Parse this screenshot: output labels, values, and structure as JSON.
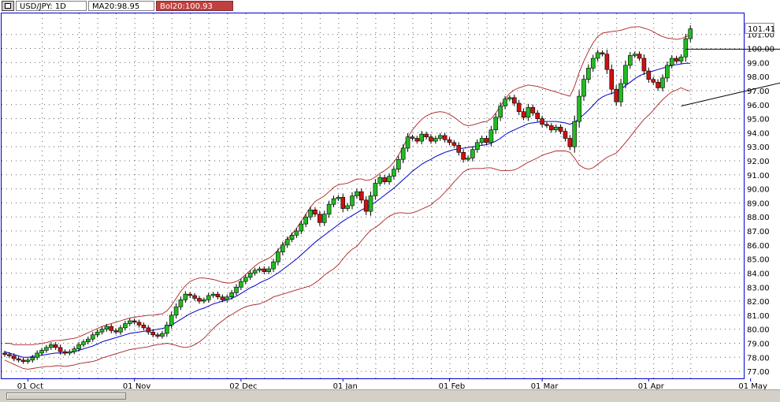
{
  "toolbar": {
    "symbol_label": "USD/JPY: 1D",
    "ma_label": "MA20:98.95",
    "bol_label": "Bol20:100.93"
  },
  "chart_data": {
    "type": "candlestick",
    "ylim": [
      76.5,
      102.5
    ],
    "y_ticks": [
      77,
      78,
      79,
      80,
      81,
      82,
      83,
      84,
      85,
      86,
      87,
      88,
      89,
      90,
      91,
      92,
      93,
      94,
      95,
      96,
      97,
      98,
      99,
      100,
      101
    ],
    "y_tick_labels": [
      "77.00",
      "78.00",
      "79.00",
      "80.00",
      "81.00",
      "82.00",
      "83.00",
      "84.00",
      "85.00",
      "86.00",
      "87.00",
      "88.00",
      "89.00",
      "90.00",
      "91.00",
      "92.00",
      "93.00",
      "94.00",
      "95.00",
      "96.00",
      "97.00",
      "98.00",
      "99.00",
      "100.00",
      "101.00"
    ],
    "x_ticks": [
      {
        "label": "01 Oct",
        "bar": 5
      },
      {
        "label": "01 Nov",
        "bar": 28
      },
      {
        "label": "02 Dec",
        "bar": 51
      },
      {
        "label": "01 Jan",
        "bar": 73
      },
      {
        "label": "01 Feb",
        "bar": 96
      },
      {
        "label": "01 Mar",
        "bar": 116
      },
      {
        "label": "01 Apr",
        "bar": 139
      },
      {
        "label": "01 May",
        "bar": 161
      }
    ],
    "last_price": "101.41",
    "colors": {
      "up": "#22bb22",
      "down": "#cc1111",
      "ma": "#0000cc",
      "bands": "#aa2222",
      "grid": "#606060",
      "axis": "#0000cc"
    },
    "close": [
      78.2,
      78.1,
      77.9,
      77.8,
      77.7,
      77.8,
      78.0,
      78.3,
      78.5,
      78.7,
      78.9,
      78.7,
      78.4,
      78.3,
      78.4,
      78.6,
      78.9,
      79.1,
      79.3,
      79.6,
      79.8,
      80.0,
      80.2,
      79.9,
      79.8,
      80.1,
      80.4,
      80.6,
      80.5,
      80.3,
      80.1,
      79.8,
      79.6,
      79.5,
      79.7,
      80.3,
      81.0,
      81.6,
      82.1,
      82.5,
      82.4,
      82.2,
      82.0,
      82.1,
      82.4,
      82.5,
      82.3,
      82.1,
      82.3,
      82.6,
      83.0,
      83.4,
      83.7,
      84.0,
      84.2,
      84.3,
      84.1,
      84.3,
      84.8,
      85.5,
      86.0,
      86.4,
      86.7,
      87.0,
      87.5,
      88.0,
      88.5,
      88.2,
      87.6,
      88.2,
      88.9,
      89.3,
      89.4,
      88.6,
      88.8,
      89.5,
      89.8,
      89.2,
      88.4,
      89.5,
      90.4,
      90.8,
      90.5,
      90.9,
      91.4,
      92.1,
      92.9,
      93.7,
      93.6,
      93.4,
      93.9,
      93.7,
      93.4,
      93.6,
      93.8,
      93.5,
      93.3,
      93.1,
      92.6,
      92.1,
      92.2,
      92.8,
      93.3,
      93.6,
      93.3,
      94.2,
      95.1,
      95.9,
      96.4,
      96.5,
      96.1,
      95.5,
      95.1,
      95.8,
      95.4,
      95.0,
      94.6,
      94.5,
      94.2,
      94.4,
      94.1,
      93.6,
      93.0,
      94.8,
      96.6,
      97.8,
      98.6,
      99.3,
      99.7,
      99.6,
      98.5,
      97.1,
      96.2,
      97.5,
      98.8,
      99.5,
      99.6,
      99.3,
      98.4,
      97.8,
      97.6,
      97.2,
      97.9,
      98.8,
      99.3,
      99.1,
      99.4,
      100.7,
      101.4
    ],
    "ma20": [
      78.4,
      78.3,
      78.2,
      78.1,
      78.0,
      78.0,
      78.05,
      78.1,
      78.15,
      78.2,
      78.25,
      78.3,
      78.3,
      78.3,
      78.35,
      78.4,
      78.5,
      78.6,
      78.7,
      78.8,
      78.95,
      79.1,
      79.2,
      79.3,
      79.4,
      79.5,
      79.6,
      79.7,
      79.75,
      79.8,
      79.85,
      79.9,
      79.95,
      80.0,
      80.05,
      80.15,
      80.3,
      80.5,
      80.7,
      80.9,
      81.1,
      81.25,
      81.4,
      81.5,
      81.65,
      81.8,
      81.9,
      82.0,
      82.1,
      82.2,
      82.35,
      82.55,
      82.75,
      82.95,
      83.1,
      83.3,
      83.45,
      83.6,
      83.8,
      84.0,
      84.25,
      84.5,
      84.75,
      85.0,
      85.3,
      85.6,
      85.9,
      86.2,
      86.45,
      86.7,
      86.95,
      87.2,
      87.45,
      87.7,
      87.9,
      88.1,
      88.3,
      88.5,
      88.65,
      88.85,
      89.05,
      89.3,
      89.55,
      89.8,
      90.05,
      90.35,
      90.65,
      90.95,
      91.25,
      91.5,
      91.75,
      91.95,
      92.1,
      92.3,
      92.45,
      92.6,
      92.7,
      92.8,
      92.85,
      92.9,
      92.95,
      93.0,
      93.05,
      93.1,
      93.15,
      93.25,
      93.4,
      93.6,
      93.85,
      94.05,
      94.2,
      94.35,
      94.5,
      94.65,
      94.7,
      94.75,
      94.8,
      94.8,
      94.8,
      94.8,
      94.75,
      94.7,
      94.6,
      94.75,
      95.0,
      95.3,
      95.6,
      95.95,
      96.3,
      96.55,
      96.7,
      96.8,
      96.9,
      97.1,
      97.35,
      97.6,
      97.85,
      98.05,
      98.2,
      98.3,
      98.4,
      98.5,
      98.6,
      98.7,
      98.8,
      98.85,
      98.9,
      98.95,
      98.95
    ],
    "bol_upper": [
      79.0,
      79.0,
      78.9,
      78.9,
      78.9,
      78.9,
      78.9,
      78.95,
      79.0,
      79.05,
      79.15,
      79.2,
      79.2,
      79.25,
      79.3,
      79.35,
      79.45,
      79.6,
      79.75,
      79.9,
      80.05,
      80.2,
      80.3,
      80.4,
      80.5,
      80.6,
      80.7,
      80.8,
      80.85,
      80.9,
      80.95,
      81.0,
      81.0,
      81.05,
      81.1,
      81.3,
      81.7,
      82.2,
      82.7,
      83.1,
      83.4,
      83.55,
      83.65,
      83.65,
      83.6,
      83.55,
      83.45,
      83.35,
      83.3,
      83.3,
      83.4,
      83.6,
      83.9,
      84.2,
      84.5,
      84.75,
      84.9,
      85.05,
      85.3,
      85.65,
      86.0,
      86.4,
      86.8,
      87.2,
      87.7,
      88.2,
      88.7,
      89.1,
      89.3,
      89.5,
      89.8,
      90.1,
      90.3,
      90.35,
      90.4,
      90.55,
      90.7,
      90.7,
      90.6,
      90.65,
      90.85,
      91.1,
      91.3,
      91.55,
      91.9,
      92.4,
      93.0,
      93.65,
      94.2,
      94.6,
      94.95,
      95.2,
      95.35,
      95.45,
      95.5,
      95.45,
      95.3,
      95.1,
      94.85,
      94.6,
      94.5,
      94.55,
      94.65,
      94.75,
      94.8,
      95.0,
      95.4,
      95.9,
      96.4,
      96.8,
      97.05,
      97.2,
      97.3,
      97.4,
      97.35,
      97.3,
      97.2,
      97.1,
      97.0,
      96.9,
      96.8,
      96.7,
      96.6,
      97.3,
      98.3,
      99.1,
      99.8,
      100.4,
      100.85,
      101.1,
      101.15,
      101.2,
      101.25,
      101.3,
      101.4,
      101.5,
      101.55,
      101.55,
      101.45,
      101.35,
      101.2,
      101.0,
      100.85,
      100.75,
      100.7,
      100.65,
      100.7,
      100.85,
      100.93
    ],
    "bol_lower": [
      77.8,
      77.65,
      77.5,
      77.35,
      77.2,
      77.15,
      77.2,
      77.25,
      77.3,
      77.35,
      77.35,
      77.4,
      77.4,
      77.35,
      77.4,
      77.45,
      77.55,
      77.6,
      77.65,
      77.7,
      77.8,
      77.95,
      78.05,
      78.15,
      78.25,
      78.35,
      78.45,
      78.55,
      78.6,
      78.65,
      78.7,
      78.75,
      78.85,
      78.9,
      78.95,
      79.0,
      78.95,
      78.85,
      78.75,
      78.7,
      78.75,
      78.9,
      79.1,
      79.35,
      79.7,
      80.05,
      80.35,
      80.6,
      80.85,
      81.05,
      81.25,
      81.45,
      81.6,
      81.7,
      81.75,
      81.8,
      81.95,
      82.1,
      82.3,
      82.4,
      82.5,
      82.6,
      82.7,
      82.8,
      82.9,
      83.0,
      83.1,
      83.3,
      83.55,
      83.85,
      84.1,
      84.3,
      84.6,
      85.0,
      85.4,
      85.7,
      85.9,
      86.3,
      86.7,
      87.05,
      87.25,
      87.5,
      87.8,
      88.05,
      88.2,
      88.3,
      88.3,
      88.25,
      88.3,
      88.4,
      88.55,
      88.7,
      88.85,
      89.15,
      89.4,
      89.75,
      90.1,
      90.5,
      90.85,
      91.2,
      91.4,
      91.45,
      91.45,
      91.45,
      91.5,
      91.5,
      91.4,
      91.3,
      91.3,
      91.3,
      91.35,
      91.5,
      91.7,
      91.9,
      92.05,
      92.2,
      92.4,
      92.5,
      92.6,
      92.7,
      92.7,
      92.7,
      92.6,
      92.2,
      91.7,
      91.5,
      91.4,
      91.5,
      91.75,
      92.0,
      92.25,
      92.4,
      92.55,
      92.9,
      93.3,
      93.7,
      94.15,
      94.55,
      94.95,
      95.25,
      95.6,
      96.0,
      96.35,
      96.65,
      96.9,
      97.05,
      97.2,
      97.05,
      96.97
    ],
    "annotations": [
      {
        "type": "trendline",
        "points": [
          [
            146,
            95.9
          ],
          [
            172,
            97.9
          ]
        ]
      },
      {
        "type": "trendline",
        "points": [
          [
            147,
            99.95
          ],
          [
            170,
            99.95
          ]
        ]
      }
    ]
  }
}
